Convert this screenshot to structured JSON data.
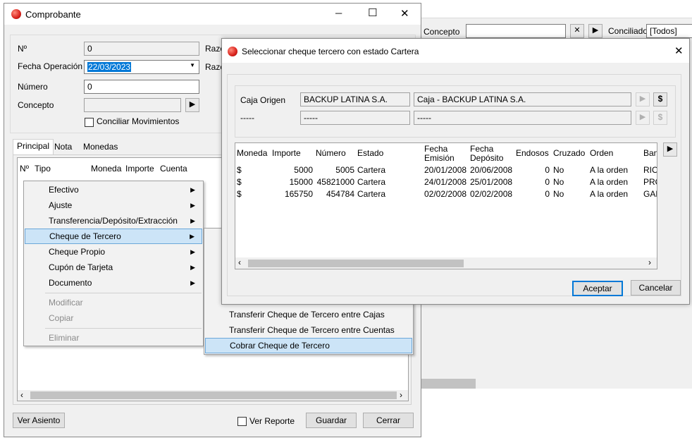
{
  "background_window": {
    "concepto_label": "Concepto",
    "concepto_value": "",
    "clear_icon": "close-icon",
    "play_icon": "play-icon",
    "conciliado_label": "Conciliado",
    "conciliado_value": "[Todos]"
  },
  "comprobante": {
    "title": "Comprobante",
    "controls": {
      "minimize": "─",
      "maximize": "☐",
      "close": "✕"
    },
    "labels": {
      "numero_sym": "Nº",
      "fecha_operacion": "Fecha Operación",
      "numero": "Número",
      "concepto": "Concepto",
      "razon1": "Razo",
      "razon2": "Razo"
    },
    "values": {
      "numero_sym": "0",
      "fecha_operacion": "22/03/2023",
      "numero": "0",
      "concepto": ""
    },
    "conciliar_label": "Conciliar Movimientos",
    "tabs": [
      "Principal",
      "Nota",
      "Monedas"
    ],
    "grid_columns": [
      "Nº",
      "Tipo",
      "Moneda",
      "Importe",
      "Cuenta"
    ],
    "buttons": {
      "ver_asiento": "Ver Asiento",
      "ver_reporte": "Ver Reporte",
      "guardar": "Guardar",
      "cerrar": "Cerrar"
    }
  },
  "context_menu": {
    "items": [
      "Efectivo",
      "Ajuste",
      "Transferencia/Depósito/Extracción",
      "Cheque de Tercero",
      "Cheque Propio",
      "Cupón de Tarjeta",
      "Documento",
      "Modificar",
      "Copiar",
      "Eliminar"
    ],
    "submenu": [
      "Transferir Cheque de Tercero entre Cajas",
      "Transferir Cheque de Tercero entre Cuentas",
      "Cobrar Cheque de Tercero"
    ]
  },
  "dialog": {
    "title": "Seleccionar cheque tercero con estado Cartera",
    "caja_origen_label": "Caja Origen",
    "caja_origen_value1": "BACKUP LATINA S.A.",
    "caja_origen_value2": "Caja - BACKUP LATINA S.A.",
    "row2_label": "-----",
    "row2_value1": "-----",
    "row2_value2": "-----",
    "dollar": "$",
    "columns": [
      "Moneda",
      "Importe",
      "Número",
      "Estado",
      "Fecha Emisión",
      "Fecha Depósito",
      "Endosos",
      "Cruzado",
      "Orden",
      "Ban"
    ],
    "columns_l1": [
      "Fecha",
      "Fecha"
    ],
    "columns_l2": [
      "Emisión",
      "Depósito"
    ],
    "rows": [
      [
        "$",
        "5000",
        "5005",
        "Cartera",
        "20/01/2008",
        "20/06/2008",
        "0",
        "No",
        "A la orden",
        "RIO"
      ],
      [
        "$",
        "15000",
        "45821000",
        "Cartera",
        "24/01/2008",
        "25/01/2008",
        "0",
        "No",
        "A la orden",
        "PRO"
      ],
      [
        "$",
        "165750",
        "454784",
        "Cartera",
        "02/02/2008",
        "02/02/2008",
        "0",
        "No",
        "A la orden",
        "GAL"
      ]
    ],
    "buttons": {
      "aceptar": "Aceptar",
      "cancelar": "Cancelar"
    }
  },
  "colors": {
    "accent": "#0078d7",
    "selection": "#cce4f7",
    "window_bg": "#f0f0f0",
    "title_icon": "#d9221c"
  }
}
